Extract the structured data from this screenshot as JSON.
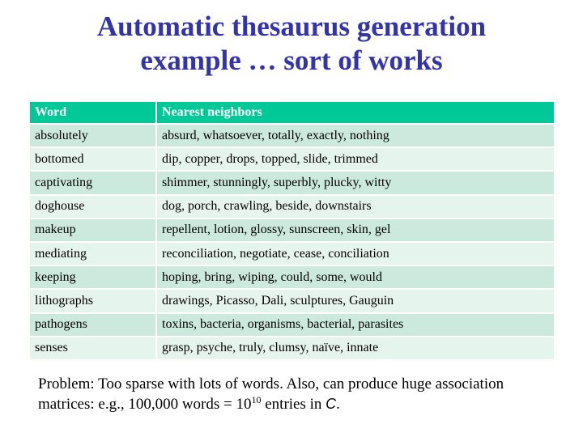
{
  "title": {
    "line1": "Automatic thesaurus generation",
    "line2": "example … sort of works"
  },
  "colors": {
    "title": "#3333aa",
    "header_bg": "#00c896",
    "row_odd": "#cce9de",
    "row_even": "#e6f4ee"
  },
  "table": {
    "headers": [
      "Word",
      "Nearest neighbors"
    ],
    "rows": [
      {
        "word": "absolutely",
        "neighbors": "absurd, whatsoever, totally, exactly, nothing"
      },
      {
        "word": "bottomed",
        "neighbors": "dip, copper, drops, topped, slide, trimmed"
      },
      {
        "word": "captivating",
        "neighbors": "shimmer, stunningly, superbly, plucky, witty"
      },
      {
        "word": "doghouse",
        "neighbors": "dog, porch, crawling, beside, downstairs"
      },
      {
        "word": "makeup",
        "neighbors": "repellent, lotion, glossy, sunscreen, skin, gel"
      },
      {
        "word": "mediating",
        "neighbors": "reconciliation, negotiate, cease, conciliation"
      },
      {
        "word": "keeping",
        "neighbors": "hoping, bring, wiping, could, some, would"
      },
      {
        "word": "lithographs",
        "neighbors": "drawings, Picasso, Dali, sculptures, Gauguin"
      },
      {
        "word": "pathogens",
        "neighbors": "toxins, bacteria, organisms, bacterial, parasites"
      },
      {
        "word": "senses",
        "neighbors": "grasp, psyche, truly, clumsy, naïve, innate"
      }
    ]
  },
  "problem": {
    "line1": "Problem: Too sparse with lots of words. Also, can produce huge association",
    "line2_prefix": "matrices: e.g., 100,000 words = 10",
    "exponent": "10",
    "line2_middle": " entries in ",
    "matrix_symbol": "C",
    "line2_suffix": "."
  }
}
